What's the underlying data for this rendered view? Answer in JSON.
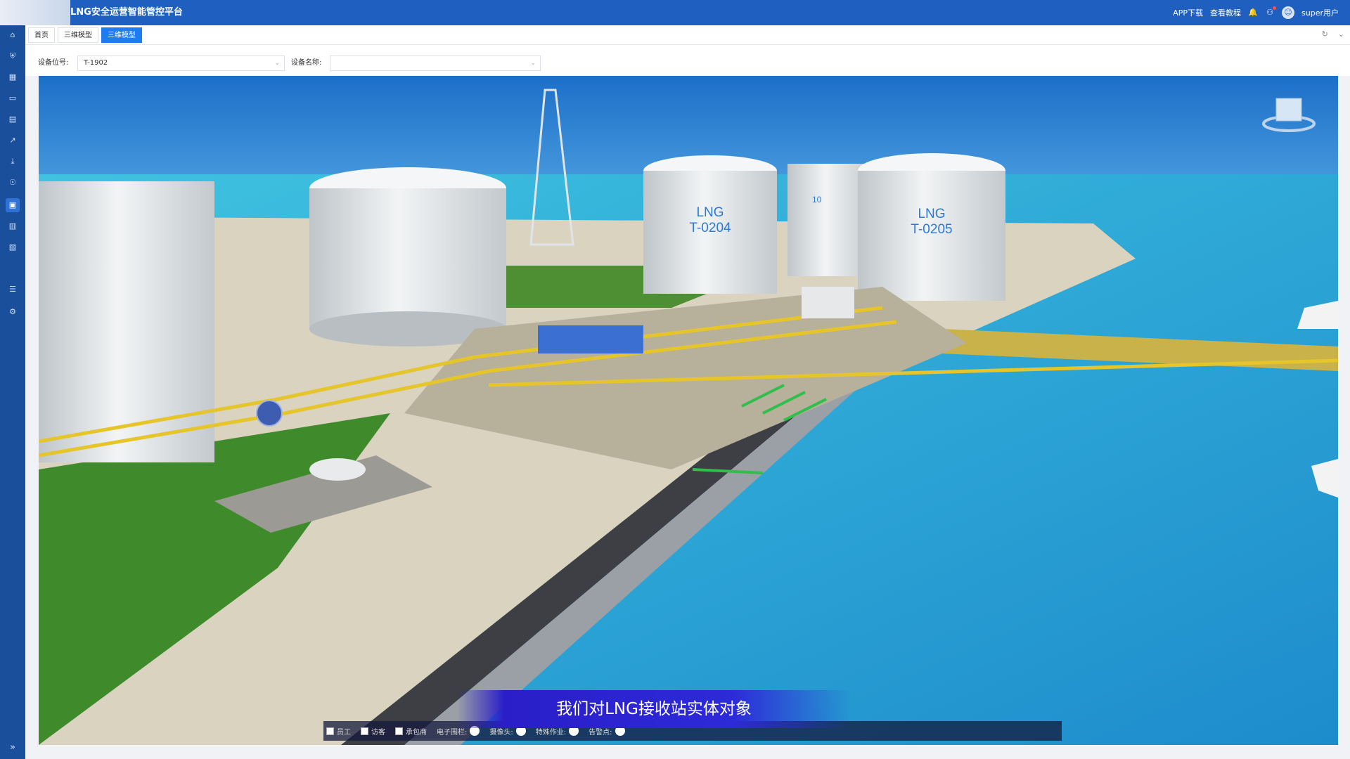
{
  "header": {
    "title": "LNG安全运营智能管控平台",
    "app_download": "APP下载",
    "tutorial": "查看教程",
    "user": "super用户"
  },
  "tabs": [
    {
      "label": "首页",
      "active": false
    },
    {
      "label": "三维模型",
      "active": false
    },
    {
      "label": "三维模型",
      "active": true
    }
  ],
  "filter": {
    "position_label": "设备位号:",
    "position_value": "T-1902",
    "name_label": "设备名称:",
    "name_value": ""
  },
  "scene": {
    "tank_labels": [
      {
        "line1": "LNG",
        "line2": "T-0204"
      },
      {
        "line1": "LNG",
        "line2": "T-0205"
      }
    ],
    "partial_tank_label": "10"
  },
  "caption": "我们对LNG接收站实体对象",
  "legend": {
    "checkboxes": [
      "员工",
      "访客",
      "承包商"
    ],
    "toggles": [
      "电子围栏:",
      "摄像头:",
      "特殊作业:",
      "告警点:"
    ]
  },
  "colors": {
    "topbar": "#1e5fbf",
    "sidebar": "#1a4f9c",
    "active_tab": "#1e7cf0",
    "sea": "#3a9cdb",
    "grass": "#3f8a2a"
  },
  "icons": [
    "home-icon",
    "shield-icon",
    "chart-icon",
    "monitor-icon",
    "doc-icon",
    "trend-icon",
    "download-icon",
    "map-icon",
    "model-icon",
    "file-icon",
    "report-icon",
    "list-icon",
    "gear-icon",
    "bell-icon",
    "user-icon",
    "refresh-icon",
    "chevron-down-icon"
  ]
}
